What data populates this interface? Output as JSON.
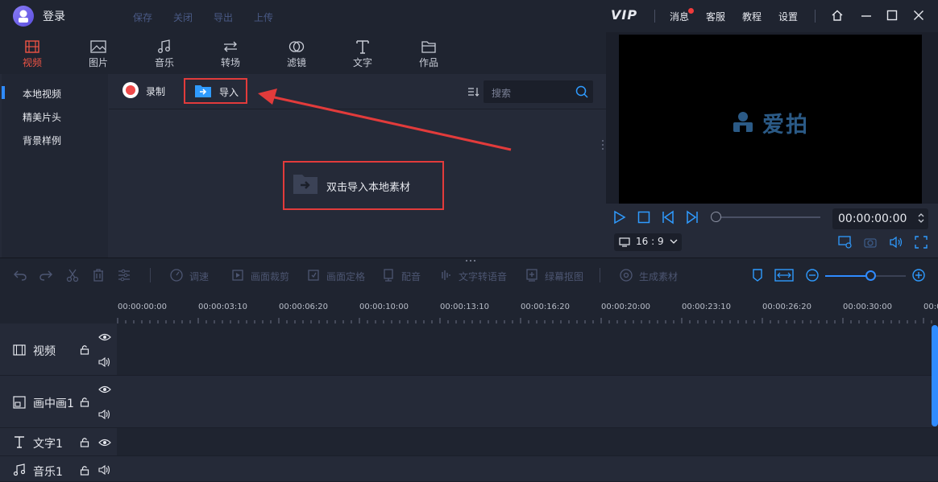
{
  "titlebar": {
    "login": "登录",
    "menu": [
      "保存",
      "关闭",
      "导出",
      "上传"
    ],
    "vip": "VIP",
    "links": [
      "消息",
      "客服",
      "教程",
      "设置"
    ]
  },
  "tabs": [
    {
      "label": "视频",
      "icon": "film-icon"
    },
    {
      "label": "图片",
      "icon": "image-icon"
    },
    {
      "label": "音乐",
      "icon": "music-icon"
    },
    {
      "label": "转场",
      "icon": "transition-icon"
    },
    {
      "label": "滤镜",
      "icon": "filter-icon"
    },
    {
      "label": "文字",
      "icon": "text-icon"
    },
    {
      "label": "作品",
      "icon": "folder-icon"
    }
  ],
  "sidebar": {
    "items": [
      "本地视频",
      "精美片头",
      "背景样例"
    ]
  },
  "library": {
    "record": "录制",
    "import": "导入",
    "search_placeholder": "搜索",
    "dropzone": "双击导入本地素材"
  },
  "preview": {
    "brand": "爱拍",
    "time": "00:00:00:00",
    "ratio": "16 : 9"
  },
  "edit_tools": [
    "调速",
    "画面裁剪",
    "画面定格",
    "配音",
    "文字转语音",
    "绿幕抠图",
    "生成素材"
  ],
  "timeline": {
    "ticks": [
      "00:00:00:00",
      "00:00:03:10",
      "00:00:06:20",
      "00:00:10:00",
      "00:00:13:10",
      "00:00:16:20",
      "00:00:20:00",
      "00:00:23:10",
      "00:00:26:20",
      "00:00:30:00",
      "00:0"
    ],
    "tracks": [
      "视频",
      "画中画1",
      "文字1",
      "音乐1"
    ]
  },
  "colors": {
    "accent": "#2f8bff",
    "active_tab": "#ef5445",
    "highlight_box": "#e23b3b"
  }
}
